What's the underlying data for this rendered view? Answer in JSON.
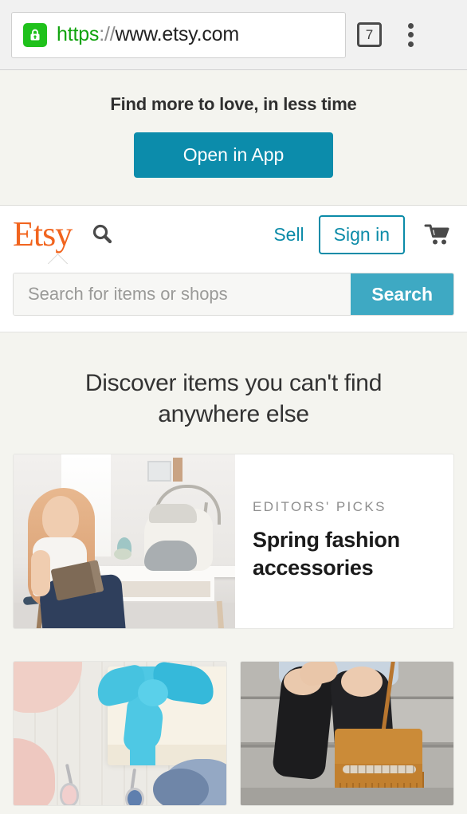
{
  "browser": {
    "security_icon": "lock-icon",
    "url_scheme": "https",
    "url_separator": "://",
    "url_host": "www.etsy.com",
    "tab_count": "7",
    "menu_icon": "overflow-menu-icon"
  },
  "app_banner": {
    "title": "Find more to love, in less time",
    "button_label": "Open in App",
    "button_color": "#0c8cab"
  },
  "site_header": {
    "logo_text": "Etsy",
    "logo_color": "#f1641e",
    "search_toggle_icon": "search-icon",
    "sell_label": "Sell",
    "signin_label": "Sign in",
    "cart_icon": "shopping-cart-icon",
    "accent_color": "#0b8ba8"
  },
  "search": {
    "placeholder": "Search for items or shops",
    "value": "",
    "button_label": "Search",
    "button_color": "#3ea9c3"
  },
  "main": {
    "heading_line1": "Discover items you can't find",
    "heading_line2": "anywhere else",
    "feature_card": {
      "eyebrow": "EDITORS' PICKS",
      "title_line1": "Spring fashion",
      "title_line2": "accessories",
      "image_alt": "woman reading a book beside a grey and white shoulder bag on a white desk"
    },
    "tiles": [
      {
        "image_alt": "gift box with turquoise bow, pink fabric and earrings on white wood"
      },
      {
        "image_alt": "person on concrete steps wearing ripped black jeans with tan fringed leather bag"
      }
    ]
  }
}
